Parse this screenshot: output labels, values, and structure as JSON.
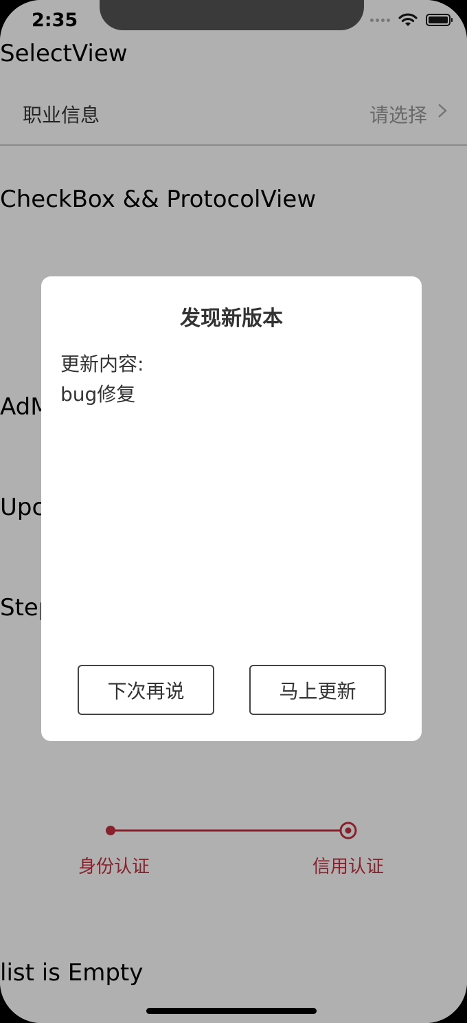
{
  "status_bar": {
    "time": "2:35"
  },
  "sections": {
    "select_view": "SelectView",
    "checkbox_protocol": "CheckBox && ProtocolView",
    "ad_partial": "AdM",
    "update_partial": "Upc",
    "step_partial": "Step",
    "list_empty": "list is Empty"
  },
  "select_row": {
    "label": "职业信息",
    "value": "请选择"
  },
  "steps": {
    "items": [
      "身份认证",
      "信用认证"
    ],
    "accent_color": "#c4303f"
  },
  "dialog": {
    "title": "发现新版本",
    "content_label": "更新内容:",
    "content_text": "bug修复",
    "later_button": "下次再说",
    "update_button": "马上更新"
  },
  "icons": [
    "wifi-icon",
    "battery-icon",
    "chevron-right-icon",
    "step-dot-icon",
    "step-current-icon"
  ]
}
